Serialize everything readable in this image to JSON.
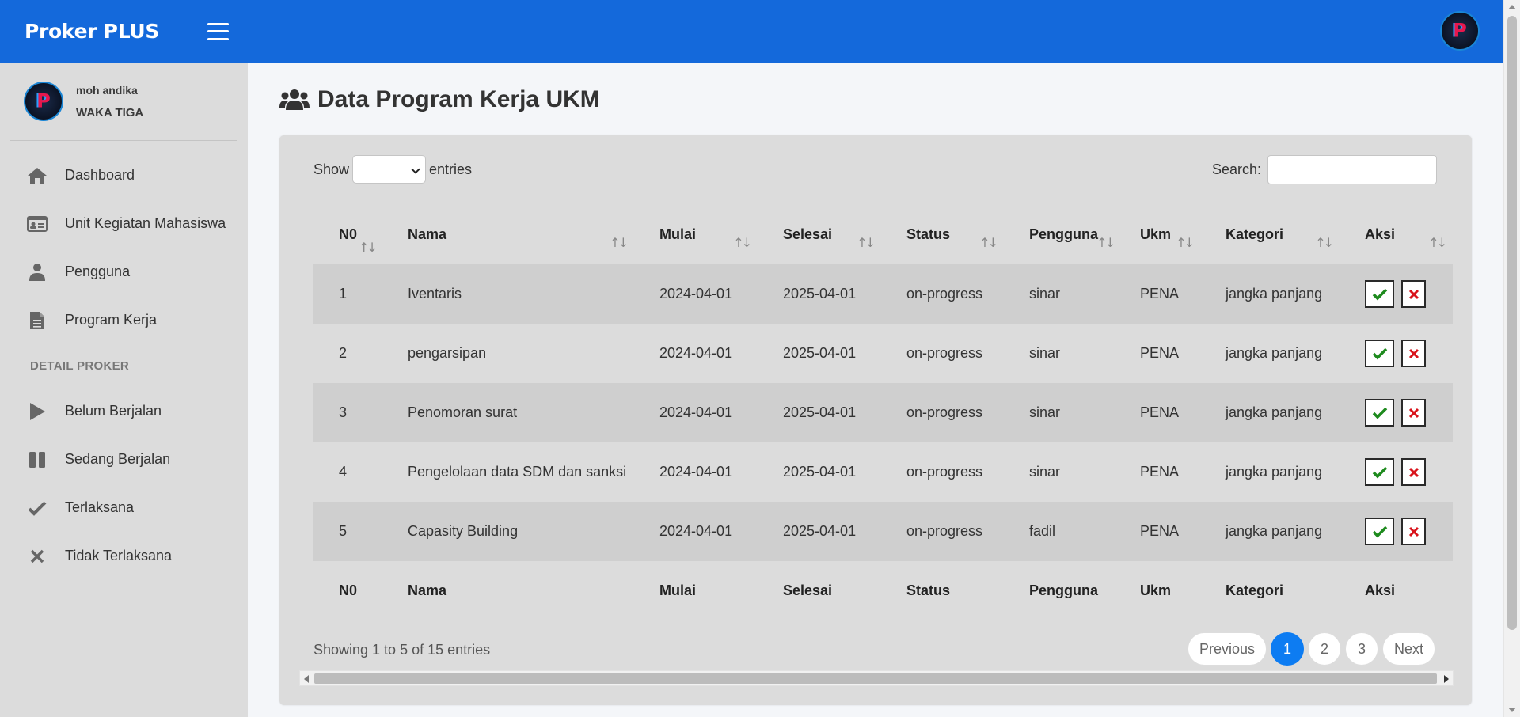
{
  "colors": {
    "topbar": "#1469db",
    "sidebar": "#dcdcdc",
    "active_page": "#0d7cf2",
    "check": "#1d8a1d",
    "cross": "#d9141c"
  },
  "app": {
    "title": "Proker PLUS",
    "menu_icon": "hamburger-icon"
  },
  "user": {
    "name": "moh andika",
    "role": "WAKA TIGA",
    "avatar_icon": "logo-p-icon"
  },
  "sidebar": {
    "items": [
      {
        "label": "Dashboard",
        "icon": "home-icon"
      },
      {
        "label": "Unit Kegiatan Mahasiswa",
        "icon": "id-card-icon"
      },
      {
        "label": "Pengguna",
        "icon": "user-icon"
      },
      {
        "label": "Program Kerja",
        "icon": "file-icon"
      }
    ],
    "section_header": "DETAIL PROKER",
    "detail_items": [
      {
        "label": "Belum Berjalan",
        "icon": "play-icon"
      },
      {
        "label": "Sedang Berjalan",
        "icon": "pause-icon"
      },
      {
        "label": "Terlaksana",
        "icon": "check-icon"
      },
      {
        "label": "Tidak Terlaksana",
        "icon": "times-icon"
      }
    ]
  },
  "page": {
    "title": "Data Program Kerja UKM",
    "title_icon": "users-icon"
  },
  "table_controls": {
    "show_label": "Show",
    "entries_label": "entries",
    "entries_value": "",
    "search_label": "Search:",
    "search_value": ""
  },
  "table": {
    "columns": [
      "N0",
      "Nama",
      "Mulai",
      "Selesai",
      "Status",
      "Pengguna",
      "Ukm",
      "Kategori",
      "Aksi"
    ],
    "rows": [
      [
        "1",
        "Iventaris",
        "2024-04-01",
        "2025-04-01",
        "on-progress",
        "sinar",
        "PENA",
        "jangka panjang"
      ],
      [
        "2",
        "pengarsipan",
        "2024-04-01",
        "2025-04-01",
        "on-progress",
        "sinar",
        "PENA",
        "jangka panjang"
      ],
      [
        "3",
        "Penomoran surat",
        "2024-04-01",
        "2025-04-01",
        "on-progress",
        "sinar",
        "PENA",
        "jangka panjang"
      ],
      [
        "4",
        "Pengelolaan data SDM dan sanksi",
        "2024-04-01",
        "2025-04-01",
        "on-progress",
        "sinar",
        "PENA",
        "jangka panjang"
      ],
      [
        "5",
        "Capasity Building",
        "2024-04-01",
        "2025-04-01",
        "on-progress",
        "fadil",
        "PENA",
        "jangka panjang"
      ]
    ],
    "sort_glyph": "↑↓"
  },
  "footer": {
    "info": "Showing 1 to 5 of 15 entries",
    "previous": "Previous",
    "pages": [
      "1",
      "2",
      "3"
    ],
    "active_page": "1",
    "next": "Next"
  }
}
